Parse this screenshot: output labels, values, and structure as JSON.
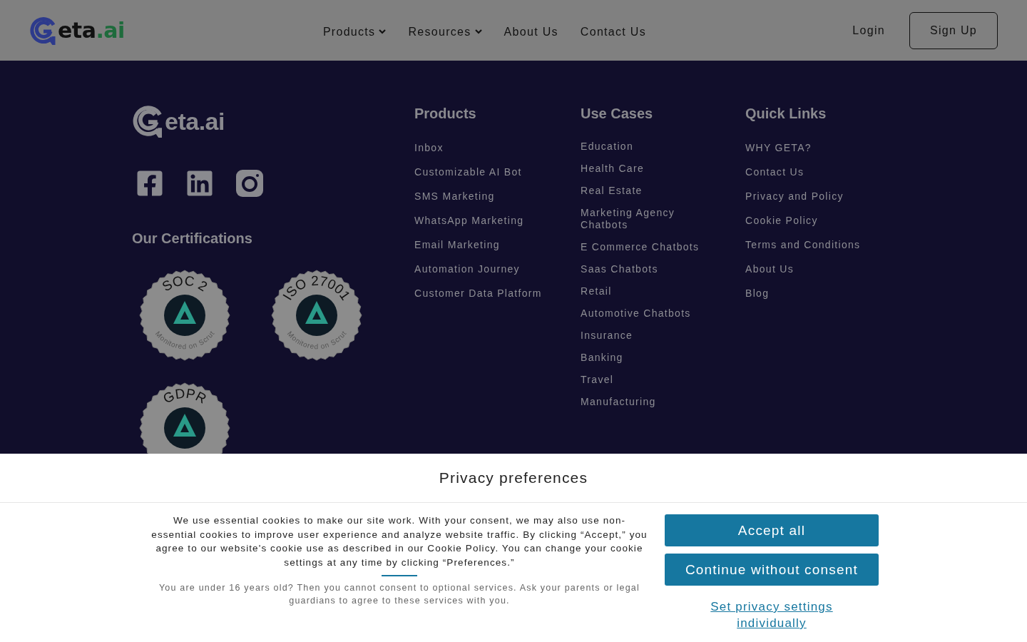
{
  "header": {
    "logo": {
      "text": "eta",
      "accent": ".ai"
    },
    "nav": [
      {
        "label": "Products",
        "dropdown": true
      },
      {
        "label": "Resources",
        "dropdown": true
      },
      {
        "label": "About Us",
        "dropdown": false
      },
      {
        "label": "Contact Us",
        "dropdown": false
      }
    ],
    "login": "Login",
    "signup": "Sign Up"
  },
  "footer": {
    "logo": {
      "text": "eta.ai"
    },
    "certifications_title": "Our Certifications",
    "badges": [
      {
        "label": "SOC 2",
        "caption": "Monitored on Scrut"
      },
      {
        "label": "ISO 27001",
        "caption": "Monitored on Scrut"
      },
      {
        "label": "GDPR"
      }
    ],
    "columns": [
      {
        "title": "Products",
        "kind": "wide",
        "links": [
          "Inbox",
          "Customizable AI Bot",
          "SMS Marketing",
          "WhatsApp Marketing",
          "Email Marketing",
          "Automation Journey",
          "Customer Data Platform"
        ]
      },
      {
        "title": "Use Cases",
        "kind": "narrow",
        "links": [
          "Education",
          "Health Care",
          "Real Estate",
          "Marketing Agency Chatbots",
          "E Commerce Chatbots",
          "Saas Chatbots",
          "Retail",
          "Automotive Chatbots",
          "Insurance",
          "Banking",
          "Travel",
          "Manufacturing"
        ]
      },
      {
        "title": "Quick Links",
        "kind": "wide",
        "links": [
          "WHY GETA?",
          "Contact Us",
          "Privacy and Policy",
          "Cookie Policy",
          "Terms and Conditions",
          "About Us",
          "Blog"
        ]
      }
    ]
  },
  "consent": {
    "title": "Privacy preferences",
    "body": "We use essential cookies to make our site work. With your consent, we may also use non-essential cookies to improve user experience and analyze website traffic. By clicking “Accept,” you agree to our website's cookie use as described in our Cookie Policy. You can change your cookie settings at any time by clicking “Preferences.”",
    "note": "You are under 16 years old? Then you cannot consent to optional services. Ask your parents or legal guardians to agree to these services with you.",
    "buttons": [
      "Accept all",
      "Continue without consent"
    ],
    "link": "Set privacy settings individually"
  }
}
